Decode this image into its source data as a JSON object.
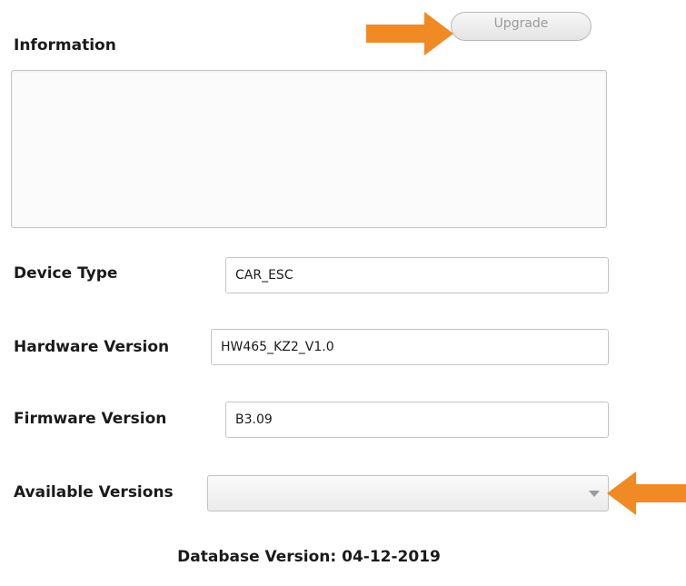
{
  "header": {
    "title": "Information",
    "upgrade_label": "Upgrade"
  },
  "info_box": {
    "content": ""
  },
  "fields": {
    "device_type": {
      "label": "Device Type",
      "value": "CAR_ESC"
    },
    "hardware_version": {
      "label": "Hardware Version",
      "value": "HW465_KZ2_V1.0"
    },
    "firmware_version": {
      "label": "Firmware Version",
      "value": "B3.09"
    },
    "available_versions": {
      "label": "Available Versions",
      "selected": ""
    }
  },
  "footer": {
    "database_version": "Database Version: 04-12-2019"
  },
  "annotations": {
    "arrow_color": "#f08a24",
    "icons": [
      "arrow-right-icon",
      "arrow-left-icon",
      "chevron-down-icon"
    ]
  }
}
